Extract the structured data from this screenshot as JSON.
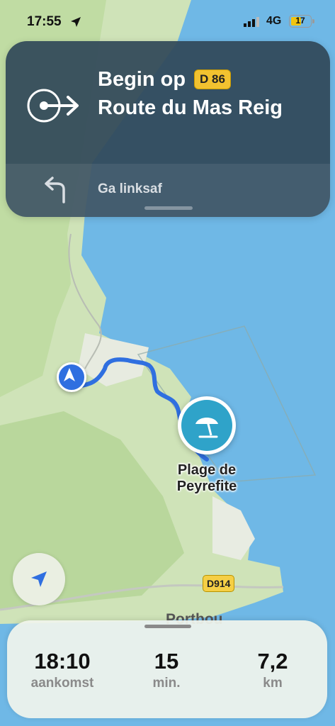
{
  "status_bar": {
    "time": "17:55",
    "network": "4G",
    "battery_level": "17"
  },
  "navigation": {
    "instruction": "Begin op",
    "road_number": "D 86",
    "road_name": "Route du Mas Reig",
    "next_instruction": "Ga linksaf"
  },
  "map": {
    "destination_name": "Plage de Peyrefite",
    "road_label": "D914",
    "town_label": "Portbou",
    "colors": {
      "sea": "#6fb8e6",
      "land": "#cfe3b8",
      "route": "#2f6fe0"
    }
  },
  "trip": {
    "arrival_value": "18:10",
    "arrival_label": "aankomst",
    "duration_value": "15",
    "duration_label": "min.",
    "distance_value": "7,2",
    "distance_label": "km"
  }
}
